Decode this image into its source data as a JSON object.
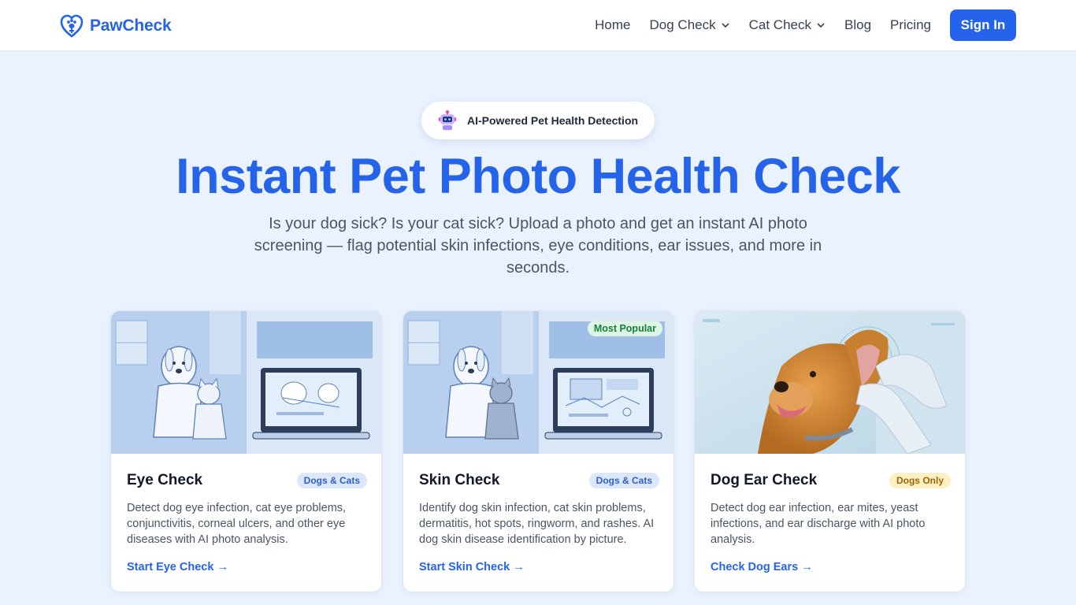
{
  "brand": {
    "name": "PawCheck",
    "accent": "#2563eb"
  },
  "nav": {
    "links": [
      {
        "label": "Home"
      },
      {
        "label": "Dog Check"
      },
      {
        "label": "Cat Check"
      },
      {
        "label": "Blog"
      },
      {
        "label": "Pricing"
      }
    ],
    "signin": "Sign In"
  },
  "hero": {
    "badge": "AI-Powered Pet Health Detection",
    "title": "Instant Pet Photo Health Check",
    "subtitle": "Is your dog sick? Is your cat sick? Upload a photo and get an instant AI photo screening — flag potential skin infections, eye conditions, ear issues, and more in seconds."
  },
  "cards": [
    {
      "title": "Eye Check",
      "tag": "Dogs & Cats",
      "description": "Detect dog eye infection, cat eye problems, conjunctivitis, corneal ulcers, and other eye diseases with AI photo analysis.",
      "link": "Start Eye Check →"
    },
    {
      "title": "Skin Check",
      "tag": "Dogs & Cats",
      "popular": "Most Popular",
      "description": "Identify dog skin infection, cat skin problems, dermatitis, hot spots, ringworm, and rashes. AI dog skin disease identification by picture.",
      "link": "Start Skin Check →"
    },
    {
      "title": "Dog Ear Check",
      "tag": "Dogs Only",
      "description": "Detect dog ear infection, ear mites, yeast infections, and ear discharge with AI photo analysis.",
      "link": "Check Dog Ears →"
    }
  ]
}
